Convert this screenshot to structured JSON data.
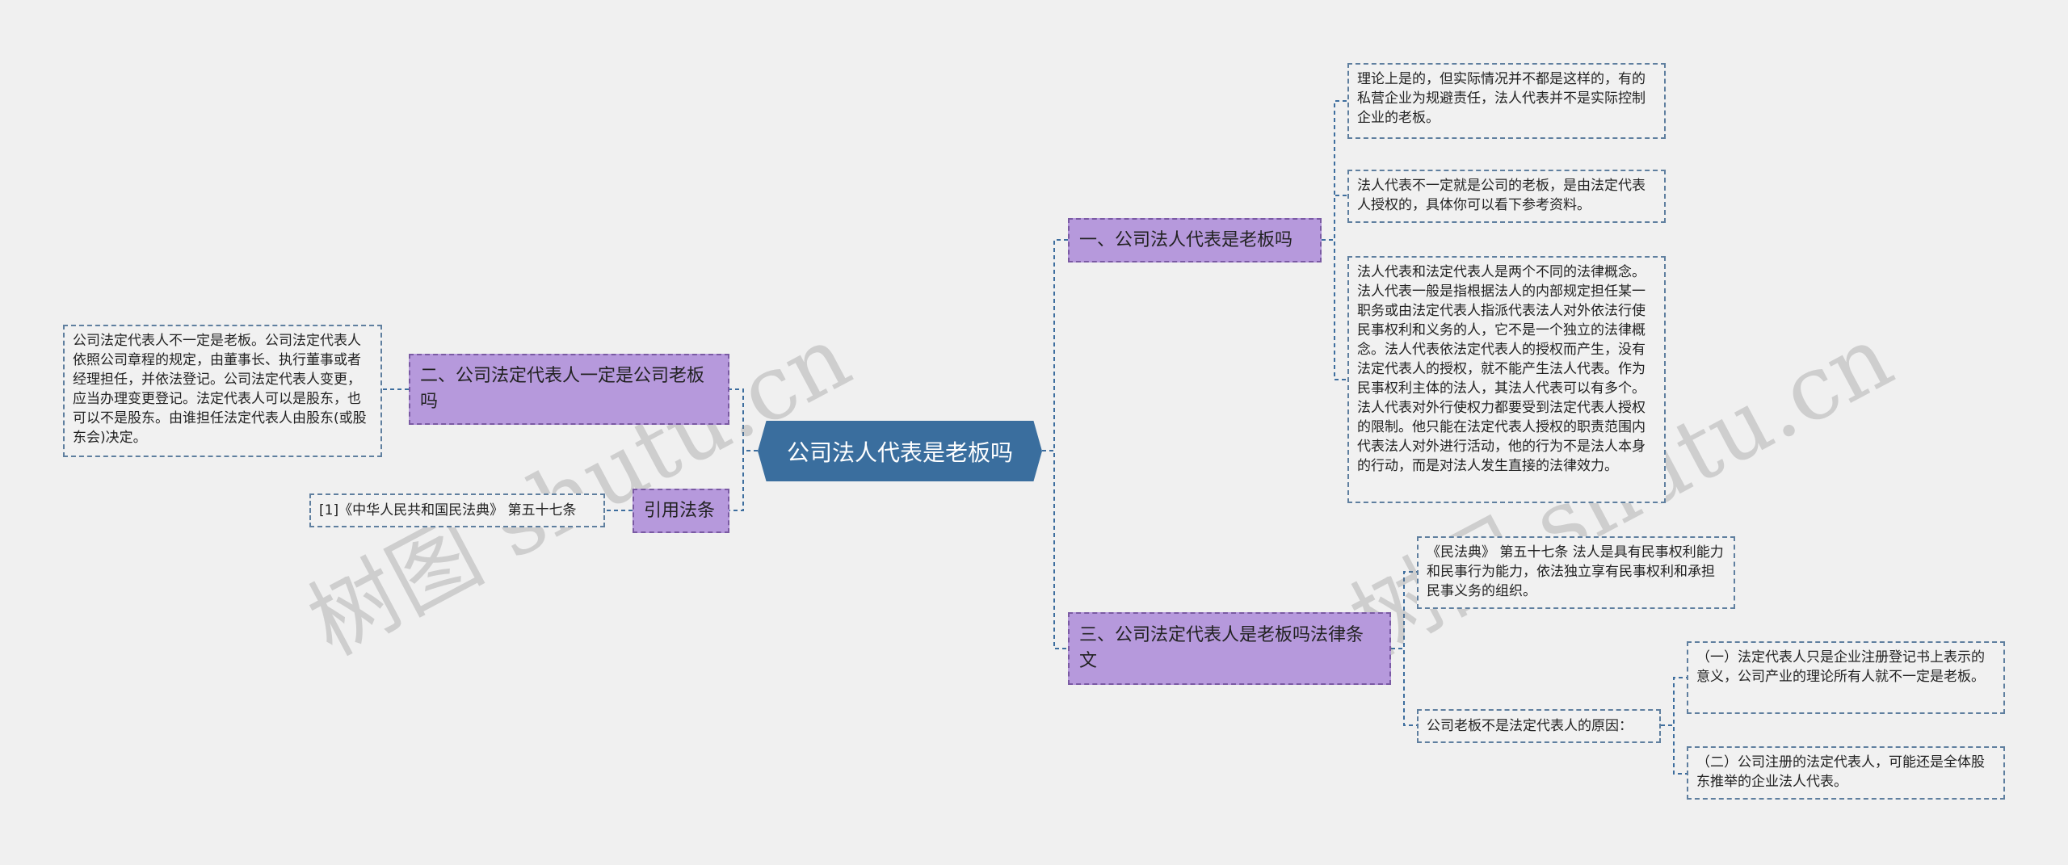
{
  "root": {
    "label": "公司法人代表是老板吗"
  },
  "branches": {
    "b1": {
      "label": "一、公司法人代表是老板吗"
    },
    "b2": {
      "label": "二、公司法定代表人一定是公司老板吗"
    },
    "b3": {
      "label": "三、公司法定代表人是老板吗法律条文"
    },
    "b4": {
      "label": "引用法条"
    }
  },
  "leaves": {
    "l1": {
      "text": "理论上是的，但实际情况并不都是这样的，有的私营企业为规避责任，法人代表并不是实际控制企业的老板。"
    },
    "l2": {
      "text": "法人代表不一定就是公司的老板，是由法定代表人授权的，具体你可以看下参考资料。"
    },
    "l3": {
      "text": "法人代表和法定代表人是两个不同的法律概念。法人代表一般是指根据法人的内部规定担任某一职务或由法定代表人指派代表法人对外依法行使民事权利和义务的人，它不是一个独立的法律概念。法人代表依法定代表人的授权而产生，没有法定代表人的授权，就不能产生法人代表。作为民事权利主体的法人，其法人代表可以有多个。法人代表对外行使权力都要受到法定代表人授权的限制。他只能在法定代表人授权的职责范围内代表法人对外进行活动，他的行为不是法人本身的行动，而是对法人发生直接的法律效力。"
    },
    "l4": {
      "text": "公司法定代表人不一定是老板。公司法定代表人依照公司章程的规定，由董事长、执行董事或者经理担任，并依法登记。公司法定代表人变更，应当办理变更登记。法定代表人可以是股东，也可以不是股东。由谁担任法定代表人由股东(或股东会)决定。"
    },
    "l5": {
      "text": "《民法典》 第五十七条 法人是具有民事权利能力和民事行为能力，依法独立享有民事权利和承担民事义务的组织。"
    },
    "l6": {
      "text": "公司老板不是法定代表人的原因："
    },
    "l7": {
      "text": "（一）法定代表人只是企业注册登记书上表示的意义，公司产业的理论所有人就不一定是老板。"
    },
    "l8": {
      "text": "（二）公司注册的法定代表人，可能还是全体股东推举的企业法人代表。"
    },
    "l9": {
      "text": "[1]《中华人民共和国民法典》 第五十七条"
    }
  },
  "watermark": {
    "text": "树图 shutu.cn"
  },
  "colors": {
    "root": "#3a6e9e",
    "branch": "#b699dc",
    "connector": "#3e6e9e",
    "background": "#f0f0f0"
  }
}
